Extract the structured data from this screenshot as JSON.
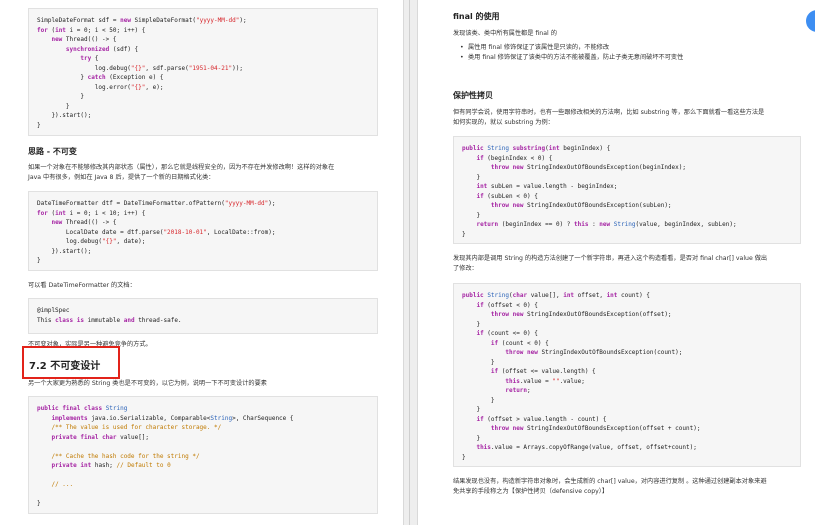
{
  "left": {
    "code1": [
      [
        [
          "plain",
          "SimpleDateFormat sdf = "
        ],
        [
          "kw2",
          "new"
        ],
        [
          "plain",
          " SimpleDateFormat("
        ],
        [
          "str",
          "\"yyyy-MM-dd\""
        ],
        [
          "plain",
          ");"
        ]
      ],
      [
        [
          "kw2",
          "for"
        ],
        [
          "plain",
          " ("
        ],
        [
          "kw2",
          "int"
        ],
        [
          "plain",
          " i = 0; i < 50; i++) {"
        ]
      ],
      [
        [
          "plain",
          "    "
        ],
        [
          "kw2",
          "new"
        ],
        [
          "plain",
          " Thread(() -> {"
        ]
      ],
      [
        [
          "plain",
          "        "
        ],
        [
          "kw2",
          "synchronized"
        ],
        [
          "plain",
          " (sdf) {"
        ]
      ],
      [
        [
          "plain",
          "            "
        ],
        [
          "kw2",
          "try"
        ],
        [
          "plain",
          " {"
        ]
      ],
      [
        [
          "plain",
          "                log.debug("
        ],
        [
          "str",
          "\"{}\""
        ],
        [
          "plain",
          ", sdf.parse("
        ],
        [
          "str",
          "\"1951-04-21\""
        ],
        [
          "plain",
          "));"
        ]
      ],
      [
        [
          "plain",
          "            } "
        ],
        [
          "kw2",
          "catch"
        ],
        [
          "plain",
          " (Exception e) {"
        ]
      ],
      [
        [
          "plain",
          "                log.error("
        ],
        [
          "str",
          "\"{}\""
        ],
        [
          "plain",
          ", e);"
        ]
      ],
      [
        [
          "plain",
          "            }"
        ]
      ],
      [
        [
          "plain",
          "        }"
        ]
      ],
      [
        [
          "plain",
          "    }).start();"
        ]
      ],
      [
        [
          "plain",
          "}"
        ]
      ]
    ],
    "heading_immutable": "思路 - 不可变",
    "para1_line1": "如果一个对象在不能够修改其内部状态（属性），那么它就是线程安全的，因为不存在并发修改啊！这样的对象在",
    "para1_line2": "Java 中有很多，例如在 Java 8 后，提供了一个新的日期格式化类：",
    "code2": [
      [
        [
          "plain",
          "DateTimeFormatter dtf = DateTimeFormatter.ofPattern("
        ],
        [
          "str",
          "\"yyyy-MM-dd\""
        ],
        [
          "plain",
          ");"
        ]
      ],
      [
        [
          "kw2",
          "for"
        ],
        [
          "plain",
          " ("
        ],
        [
          "kw2",
          "int"
        ],
        [
          "plain",
          " i = 0; i < 10; i++) {"
        ]
      ],
      [
        [
          "plain",
          "    "
        ],
        [
          "kw2",
          "new"
        ],
        [
          "plain",
          " Thread(() -> {"
        ]
      ],
      [
        [
          "plain",
          "        LocalDate date = dtf.parse("
        ],
        [
          "str",
          "\"2018-10-01\""
        ],
        [
          "plain",
          ", LocalDate::from);"
        ]
      ],
      [
        [
          "plain",
          "        log.debug("
        ],
        [
          "str",
          "\"{}\""
        ],
        [
          "plain",
          ", date);"
        ]
      ],
      [
        [
          "plain",
          "    }).start();"
        ]
      ],
      [
        [
          "plain",
          "}"
        ]
      ]
    ],
    "para2": "可以看 DateTimeFormatter 的文档：",
    "code3": [
      [
        [
          "plain",
          "@implSpec"
        ]
      ],
      [
        [
          "plain",
          "This "
        ],
        [
          "kw2",
          "class"
        ],
        [
          "plain",
          " "
        ],
        [
          "kw2",
          "is"
        ],
        [
          "plain",
          " immutable "
        ],
        [
          "kw2",
          "and"
        ],
        [
          "plain",
          " thread-safe."
        ]
      ]
    ],
    "para3": "不可变对象，实际是另一种避免竞争的方式。",
    "section_heading": "7.2 不可变设计",
    "para4": "另一个大家更为熟悉的 String 类也是不可变的，以它为例，说明一下不可变设计的要素",
    "code4": [
      [
        [
          "kw2",
          "public"
        ],
        [
          "plain",
          " "
        ],
        [
          "kw2",
          "final"
        ],
        [
          "plain",
          " "
        ],
        [
          "kw2",
          "class"
        ],
        [
          "plain",
          " "
        ],
        [
          "ty",
          "String"
        ]
      ],
      [
        [
          "plain",
          "    "
        ],
        [
          "kw2",
          "implements"
        ],
        [
          "plain",
          " java.io.Serializable, Comparable<"
        ],
        [
          "ty",
          "String"
        ],
        [
          "plain",
          ">, CharSequence {"
        ]
      ],
      [
        [
          "plain",
          "    "
        ],
        [
          "cm",
          "/** The value is used for character storage. */"
        ]
      ],
      [
        [
          "plain",
          "    "
        ],
        [
          "kw2",
          "private"
        ],
        [
          "plain",
          " "
        ],
        [
          "kw2",
          "final"
        ],
        [
          "plain",
          " "
        ],
        [
          "kw2",
          "char"
        ],
        [
          "plain",
          " value[];"
        ]
      ],
      [
        [
          "plain",
          ""
        ]
      ],
      [
        [
          "plain",
          "    "
        ],
        [
          "cm",
          "/** Cache the hash code for the string */"
        ]
      ],
      [
        [
          "plain",
          "    "
        ],
        [
          "kw2",
          "private"
        ],
        [
          "plain",
          " "
        ],
        [
          "kw2",
          "int"
        ],
        [
          "plain",
          " hash; "
        ],
        [
          "cm",
          "// Default to 0"
        ]
      ],
      [
        [
          "plain",
          ""
        ]
      ],
      [
        [
          "plain",
          "    "
        ],
        [
          "cm",
          "// ..."
        ]
      ],
      [
        [
          "plain",
          ""
        ]
      ],
      [
        [
          "plain",
          "}"
        ]
      ]
    ]
  },
  "right": {
    "heading_final": "final 的使用",
    "para_final": "发现该类、类中所有属性都是 final 的",
    "bullets": [
      "属性用 final 修饰保证了该属性是只读的，不能修改",
      "类用 final 修饰保证了该类中的方法不能被覆盖，防止子类无意间破坏不可变性"
    ],
    "heading_copy": "保护性拷贝",
    "para_copy_line1": "但有同学会说，使用字符串时，也有一些跟修改相关的方法啊，比如 substring 等，那么下面就看一看这些方法是",
    "para_copy_line2": "如何实现的，就以 substring 为例：",
    "code5": [
      [
        [
          "kw2",
          "public"
        ],
        [
          "plain",
          " "
        ],
        [
          "ty",
          "String"
        ],
        [
          "plain",
          " "
        ],
        [
          "kw2",
          "substring"
        ],
        [
          "plain",
          "("
        ],
        [
          "kw2",
          "int"
        ],
        [
          "plain",
          " beginIndex) {"
        ]
      ],
      [
        [
          "plain",
          "    "
        ],
        [
          "kw2",
          "if"
        ],
        [
          "plain",
          " (beginIndex < 0) {"
        ]
      ],
      [
        [
          "plain",
          "        "
        ],
        [
          "kw2",
          "throw"
        ],
        [
          "plain",
          " "
        ],
        [
          "kw2",
          "new"
        ],
        [
          "plain",
          " StringIndexOutOfBoundsException(beginIndex);"
        ]
      ],
      [
        [
          "plain",
          "    }"
        ]
      ],
      [
        [
          "plain",
          "    "
        ],
        [
          "kw2",
          "int"
        ],
        [
          "plain",
          " subLen = value.length - beginIndex;"
        ]
      ],
      [
        [
          "plain",
          "    "
        ],
        [
          "kw2",
          "if"
        ],
        [
          "plain",
          " (subLen < 0) {"
        ]
      ],
      [
        [
          "plain",
          "        "
        ],
        [
          "kw2",
          "throw"
        ],
        [
          "plain",
          " "
        ],
        [
          "kw2",
          "new"
        ],
        [
          "plain",
          " StringIndexOutOfBoundsException(subLen);"
        ]
      ],
      [
        [
          "plain",
          "    }"
        ]
      ],
      [
        [
          "plain",
          "    "
        ],
        [
          "kw2",
          "return"
        ],
        [
          "plain",
          " (beginIndex == 0) ? "
        ],
        [
          "kw2",
          "this"
        ],
        [
          "plain",
          " : "
        ],
        [
          "kw2",
          "new"
        ],
        [
          "plain",
          " "
        ],
        [
          "ty",
          "String"
        ],
        [
          "plain",
          "(value, beginIndex, subLen);"
        ]
      ],
      [
        [
          "plain",
          "}"
        ]
      ]
    ],
    "para_ctor_line1": "发现其内部是调用 String 的构造方法创建了一个新字符串，再进入这个构造看看，是否对 final char[] value 做出",
    "para_ctor_line2": "了修改：",
    "code6": [
      [
        [
          "kw2",
          "public"
        ],
        [
          "plain",
          " "
        ],
        [
          "ty",
          "String"
        ],
        [
          "plain",
          "("
        ],
        [
          "kw2",
          "char"
        ],
        [
          "plain",
          " value[], "
        ],
        [
          "kw2",
          "int"
        ],
        [
          "plain",
          " offset, "
        ],
        [
          "kw2",
          "int"
        ],
        [
          "plain",
          " count) {"
        ]
      ],
      [
        [
          "plain",
          "    "
        ],
        [
          "kw2",
          "if"
        ],
        [
          "plain",
          " (offset < 0) {"
        ]
      ],
      [
        [
          "plain",
          "        "
        ],
        [
          "kw2",
          "throw"
        ],
        [
          "plain",
          " "
        ],
        [
          "kw2",
          "new"
        ],
        [
          "plain",
          " StringIndexOutOfBoundsException(offset);"
        ]
      ],
      [
        [
          "plain",
          "    }"
        ]
      ],
      [
        [
          "plain",
          "    "
        ],
        [
          "kw2",
          "if"
        ],
        [
          "plain",
          " (count <= 0) {"
        ]
      ],
      [
        [
          "plain",
          "        "
        ],
        [
          "kw2",
          "if"
        ],
        [
          "plain",
          " (count < 0) {"
        ]
      ],
      [
        [
          "plain",
          "            "
        ],
        [
          "kw2",
          "throw"
        ],
        [
          "plain",
          " "
        ],
        [
          "kw2",
          "new"
        ],
        [
          "plain",
          " StringIndexOutOfBoundsException(count);"
        ]
      ],
      [
        [
          "plain",
          "        }"
        ]
      ],
      [
        [
          "plain",
          "        "
        ],
        [
          "kw2",
          "if"
        ],
        [
          "plain",
          " (offset <= value.length) {"
        ]
      ],
      [
        [
          "plain",
          "            "
        ],
        [
          "kw2",
          "this"
        ],
        [
          "plain",
          ".value = "
        ],
        [
          "str",
          "\"\""
        ],
        [
          "plain",
          ".value;"
        ]
      ],
      [
        [
          "plain",
          "            "
        ],
        [
          "kw2",
          "return"
        ],
        [
          "plain",
          ";"
        ]
      ],
      [
        [
          "plain",
          "        }"
        ]
      ],
      [
        [
          "plain",
          "    }"
        ]
      ],
      [
        [
          "plain",
          "    "
        ],
        [
          "kw2",
          "if"
        ],
        [
          "plain",
          " (offset > value.length - count) {"
        ]
      ],
      [
        [
          "plain",
          "        "
        ],
        [
          "kw2",
          "throw"
        ],
        [
          "plain",
          " "
        ],
        [
          "kw2",
          "new"
        ],
        [
          "plain",
          " StringIndexOutOfBoundsException(offset + count);"
        ]
      ],
      [
        [
          "plain",
          "    }"
        ]
      ],
      [
        [
          "plain",
          "    "
        ],
        [
          "kw2",
          "this"
        ],
        [
          "plain",
          ".value = Arrays.copyOfRange(value, offset, offset+count);"
        ]
      ],
      [
        [
          "plain",
          "}"
        ]
      ]
    ],
    "para_end_line1": "结果发现也没有，构造新字符串对象时，会生成新的 char[] value，对内容进行复制 。这种通过创建副本对象来避",
    "para_end_line2": "免共享的手段称之为【保护性拷贝（defensive copy）】"
  },
  "colors": {
    "highlight_box": "#e2231a",
    "keyword": "#a626a4",
    "string": "#d7262b",
    "comment": "#c07a00",
    "type": "#2a62b8",
    "fab": "#3d8ef2"
  }
}
